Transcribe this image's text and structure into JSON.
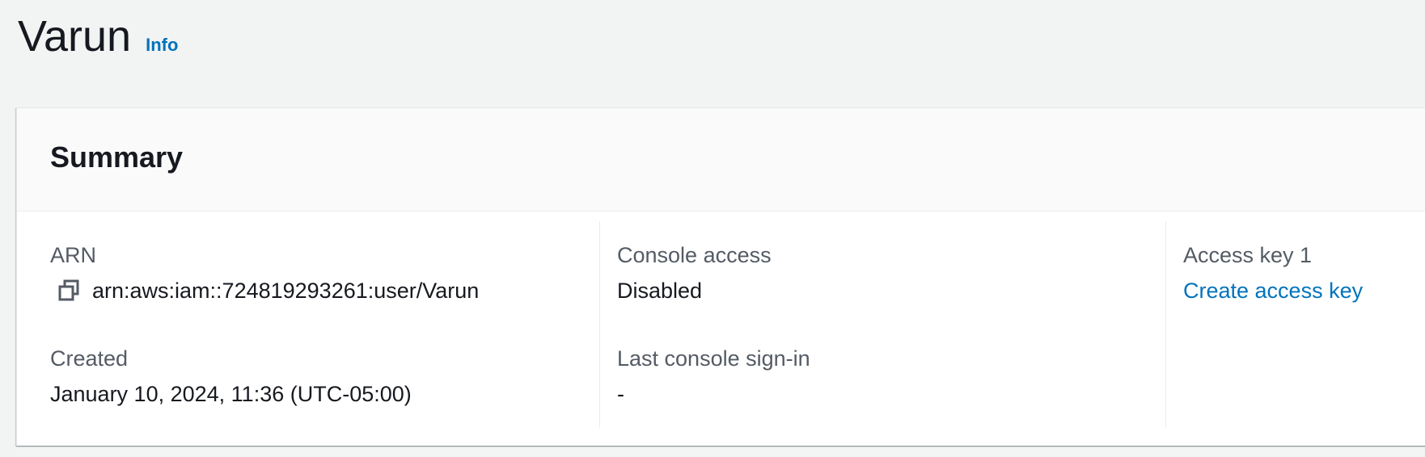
{
  "header": {
    "title": "Varun",
    "info_label": "Info"
  },
  "summary": {
    "title": "Summary",
    "arn": {
      "label": "ARN",
      "value": "arn:aws:iam::724819293261:user/Varun",
      "copy_icon": "copy-icon"
    },
    "created": {
      "label": "Created",
      "value": "January 10, 2024, 11:36 (UTC-05:00)"
    },
    "console_access": {
      "label": "Console access",
      "value": "Disabled"
    },
    "last_console_signin": {
      "label": "Last console sign-in",
      "value": "-"
    },
    "access_key_1": {
      "label": "Access key 1",
      "link": "Create access key"
    }
  },
  "colors": {
    "link": "#0073bb",
    "text": "#16191f",
    "label": "#545b64",
    "background": "#f2f3f3"
  }
}
